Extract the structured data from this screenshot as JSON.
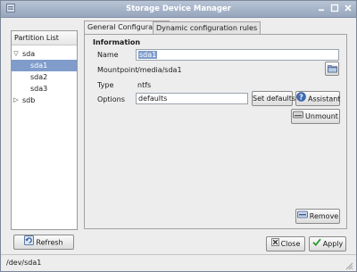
{
  "window": {
    "title": "Storage Device Manager"
  },
  "partition_list": {
    "header": "Partition List",
    "items": [
      {
        "label": "sda",
        "expanded": true
      },
      {
        "label": "sda1",
        "selected": true
      },
      {
        "label": "sda2"
      },
      {
        "label": "sda3"
      },
      {
        "label": "sdb",
        "expanded": false
      }
    ]
  },
  "tabs": [
    {
      "label": "General Configuration",
      "active": true
    },
    {
      "label": "Dynamic configuration rules",
      "active": false
    }
  ],
  "info": {
    "section_title": "Information",
    "name_label": "Name",
    "name_value": "sda1",
    "mountpoint_label": "Mountpoint",
    "mountpoint_value": "/media/sda1",
    "type_label": "Type",
    "type_value": "ntfs",
    "options_label": "Options",
    "options_value": "defaults"
  },
  "buttons": {
    "set_defaults": "Set defaults",
    "assistant": "Assistant",
    "unmount": "Unmount",
    "remove": "Remove",
    "refresh": "Refresh",
    "close": "Close",
    "apply": "Apply"
  },
  "status": {
    "text": "/dev/sda1"
  },
  "colors": {
    "selection": "#7f9ccb",
    "titlebar": "#a6b4ca"
  }
}
